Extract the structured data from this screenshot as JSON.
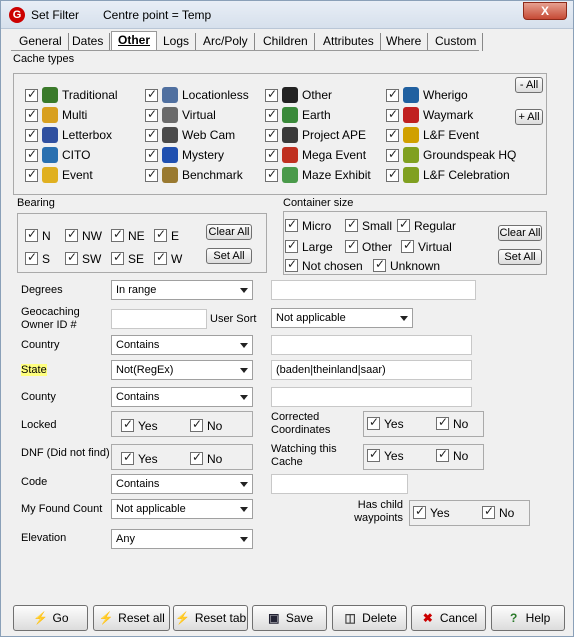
{
  "window": {
    "title": "Set Filter",
    "centre_point": "Centre point = Temp",
    "close_label": "X"
  },
  "tabs": [
    "General",
    "Dates",
    "Other",
    "Logs",
    "Arc/Poly",
    "Children",
    "Attributes",
    "Where",
    "Custom"
  ],
  "active_tab": "Other",
  "cache_types": {
    "label": "Cache types",
    "minus_all": "- All",
    "plus_all": "+ All",
    "items": [
      {
        "label": "Traditional",
        "icon": "traditional-icon",
        "color": "#3a7a2a"
      },
      {
        "label": "Multi",
        "icon": "multi-icon",
        "color": "#d8a020"
      },
      {
        "label": "Letterbox",
        "icon": "letterbox-icon",
        "color": "#3050a0"
      },
      {
        "label": "CITO",
        "icon": "cito-icon",
        "color": "#2a70b0"
      },
      {
        "label": "Event",
        "icon": "event-icon",
        "color": "#e0b020"
      },
      {
        "label": "Locationless",
        "icon": "locationless-icon",
        "color": "#5070a0"
      },
      {
        "label": "Virtual",
        "icon": "virtual-icon",
        "color": "#6a6a6a"
      },
      {
        "label": "Web Cam",
        "icon": "webcam-icon",
        "color": "#4a4a4a"
      },
      {
        "label": "Mystery",
        "icon": "mystery-icon",
        "color": "#2050b0"
      },
      {
        "label": "Benchmark",
        "icon": "benchmark-icon",
        "color": "#9a7a30"
      },
      {
        "label": "Other",
        "icon": "other-icon",
        "color": "#222222"
      },
      {
        "label": "Earth",
        "icon": "earth-icon",
        "color": "#3a8a3a"
      },
      {
        "label": "Project APE",
        "icon": "ape-icon",
        "color": "#3a3a3a"
      },
      {
        "label": "Mega Event",
        "icon": "mega-event-icon",
        "color": "#c03020"
      },
      {
        "label": "Maze Exhibit",
        "icon": "maze-icon",
        "color": "#4a9a4a"
      },
      {
        "label": "Wherigo",
        "icon": "wherigo-icon",
        "color": "#2060a0"
      },
      {
        "label": "Waymark",
        "icon": "waymark-icon",
        "color": "#c02020"
      },
      {
        "label": "L&F Event",
        "icon": "lf-event-icon",
        "color": "#d0a000"
      },
      {
        "label": "Groundspeak HQ",
        "icon": "hq-icon",
        "color": "#80a020"
      },
      {
        "label": "L&F Celebration",
        "icon": "lf-celebration-icon",
        "color": "#80a020"
      }
    ]
  },
  "bearing": {
    "label": "Bearing",
    "items": [
      "N",
      "NW",
      "NE",
      "E",
      "S",
      "SW",
      "SE",
      "W"
    ],
    "clear_all": "Clear All",
    "set_all": "Set All"
  },
  "container": {
    "label": "Container size",
    "items": [
      "Micro",
      "Small",
      "Regular",
      "Large",
      "Other",
      "Virtual",
      "Not chosen",
      "Unknown"
    ],
    "clear_all": "Clear All",
    "set_all": "Set All"
  },
  "fields": {
    "degrees": {
      "label": "Degrees",
      "value": "In range"
    },
    "owner": {
      "label": "Geocaching Owner ID #",
      "value": ""
    },
    "user_sort": {
      "label": "User Sort",
      "value": "Not applicable"
    },
    "country": {
      "label": "Country",
      "value": "Contains",
      "text": ""
    },
    "state": {
      "label": "State",
      "value": "Not(RegEx)",
      "text": "(baden|theinland|saar)"
    },
    "county": {
      "label": "County",
      "value": "Contains",
      "text": ""
    },
    "locked": {
      "label": "Locked",
      "yes": "Yes",
      "no": "No"
    },
    "dnf": {
      "label": "DNF (Did not find)",
      "yes": "Yes",
      "no": "No"
    },
    "corrected": {
      "label": "Corrected Coordinates",
      "yes": "Yes",
      "no": "No"
    },
    "watching": {
      "label": "Watching this Cache",
      "yes": "Yes",
      "no": "No"
    },
    "code": {
      "label": "Code",
      "value": "Contains",
      "text": ""
    },
    "found_count": {
      "label": "My Found Count",
      "value": "Not applicable"
    },
    "child_waypoints": {
      "label": "Has child waypoints",
      "yes": "Yes",
      "no": "No"
    },
    "elevation": {
      "label": "Elevation",
      "value": "Any"
    }
  },
  "buttons": {
    "go": "Go",
    "reset_all": "Reset all",
    "reset_tab": "Reset tab",
    "save": "Save",
    "delete": "Delete",
    "cancel": "Cancel",
    "help": "Help"
  }
}
